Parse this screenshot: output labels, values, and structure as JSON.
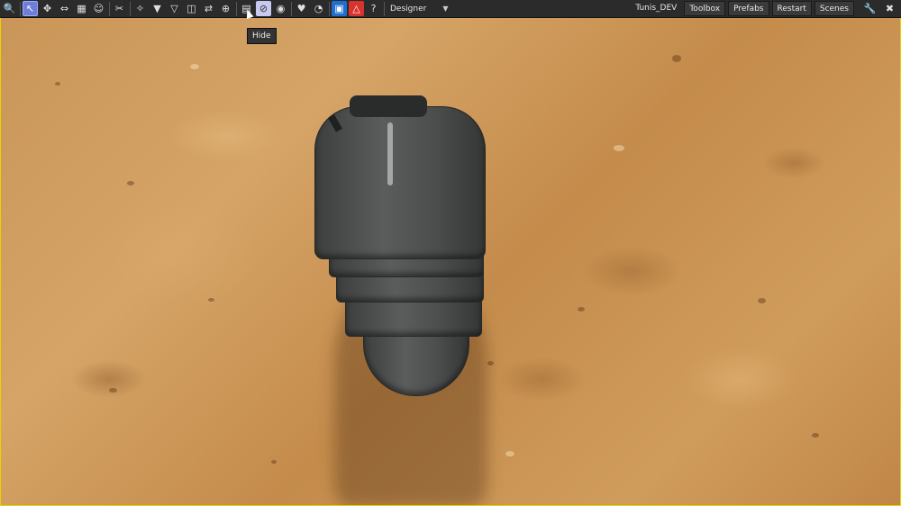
{
  "toolbar": {
    "left_icons": [
      {
        "name": "search-icon",
        "glyph": "🔍"
      },
      {
        "name": "select-tool-icon",
        "glyph": "↖"
      },
      {
        "name": "move-tool-icon",
        "glyph": "✥"
      },
      {
        "name": "scale-tool-icon",
        "glyph": "⇔"
      },
      {
        "name": "snap-tool-icon",
        "glyph": "▦"
      },
      {
        "name": "smile-icon",
        "glyph": "☺"
      },
      {
        "name": "scissors-icon",
        "glyph": "✂"
      },
      {
        "name": "pivot-icon",
        "glyph": "✧"
      },
      {
        "name": "filter-down-icon",
        "glyph": "▼"
      },
      {
        "name": "triangle-down-icon",
        "glyph": "▽"
      },
      {
        "name": "split-view-icon",
        "glyph": "◫"
      },
      {
        "name": "shuffle-icon",
        "glyph": "⇄"
      },
      {
        "name": "crosshair-icon",
        "glyph": "⊕"
      },
      {
        "name": "document-icon",
        "glyph": "▤"
      },
      {
        "name": "hide-icon",
        "glyph": "⊘"
      },
      {
        "name": "eye-icon",
        "glyph": "◉"
      },
      {
        "name": "heart-icon",
        "glyph": "♥"
      },
      {
        "name": "timer-icon",
        "glyph": "◔"
      },
      {
        "name": "save-icon",
        "glyph": "▣"
      },
      {
        "name": "warning-icon",
        "glyph": "△"
      },
      {
        "name": "help-icon",
        "glyph": "?"
      }
    ],
    "mode_label": "Designer",
    "mode_arrow": "▼",
    "project_name": "Tunis_DEV",
    "toolbox_label": "Toolbox",
    "prefabs_label": "Prefabs",
    "restart_label": "Restart",
    "scenes_label": "Scenes",
    "wrench_icon": "🔧",
    "close_icon": "✖",
    "tooltip": "Hide"
  },
  "colors": {
    "toolbar_bg": "#2b2b2b",
    "active_tool": "#6f7fd8",
    "viewport_border": "#e8d400",
    "sand": "#c99558"
  }
}
